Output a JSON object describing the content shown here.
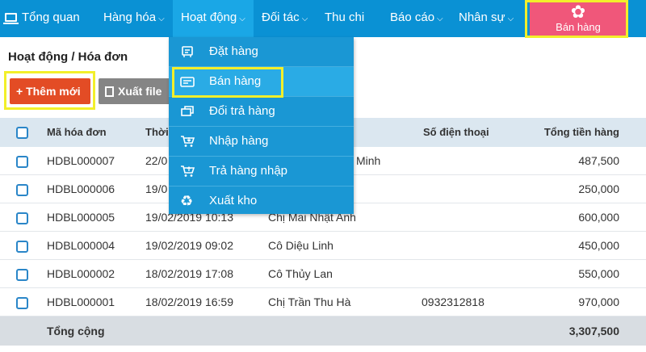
{
  "nav": {
    "overview": "Tổng quan",
    "goods": "Hàng hóa",
    "activities": "Hoạt động",
    "partners": "Đối tác",
    "cashbook": "Thu chi",
    "reports": "Báo cáo",
    "staff": "Nhân sự",
    "sell": "Bán hàng"
  },
  "dropdown": {
    "items": [
      "Đặt hàng",
      "Bán hàng",
      "Đổi trả hàng",
      "Nhập hàng",
      "Trả hàng nhập",
      "Xuất kho"
    ],
    "icons": [
      "order-icon",
      "sale-icon",
      "return-icon",
      "import-cart-icon",
      "return-import-icon",
      "recycle-icon"
    ]
  },
  "page": {
    "title": "Hoạt động / Hóa đơn",
    "add_button": "+ Thêm mới",
    "export_button": "Xuất file"
  },
  "table": {
    "headers": {
      "code": "Mã hóa đơn",
      "time": "Thời",
      "customer": "",
      "phone": "Số điện thoại",
      "total": "Tổng tiền hàng"
    },
    "rows": [
      {
        "code": "HDBL000007",
        "time": "22/0",
        "customer": "Minh",
        "phone": "",
        "total": "487,500"
      },
      {
        "code": "HDBL000006",
        "time": "19/0",
        "customer": "",
        "phone": "",
        "total": "250,000"
      },
      {
        "code": "HDBL000005",
        "time": "19/02/2019 10:13",
        "customer": "Chị Mai Nhật Anh",
        "phone": "",
        "total": "600,000"
      },
      {
        "code": "HDBL000004",
        "time": "19/02/2019 09:02",
        "customer": "Cô Diệu Linh",
        "phone": "",
        "total": "450,000"
      },
      {
        "code": "HDBL000002",
        "time": "18/02/2019 17:08",
        "customer": "Cô Thủy Lan",
        "phone": "",
        "total": "550,000"
      },
      {
        "code": "HDBL000001",
        "time": "18/02/2019 16:59",
        "customer": "Chị Trần Thu Hà",
        "phone": "0932312818",
        "total": "970,000"
      }
    ],
    "footer": {
      "label": "Tổng cộng",
      "total": "3,307,500"
    }
  },
  "colors": {
    "topbar": "#0a91d4",
    "dropdown": "#1a97d4",
    "sell_button": "#f0577a",
    "add_button": "#e34c25",
    "highlight": "#f2ef2a"
  }
}
